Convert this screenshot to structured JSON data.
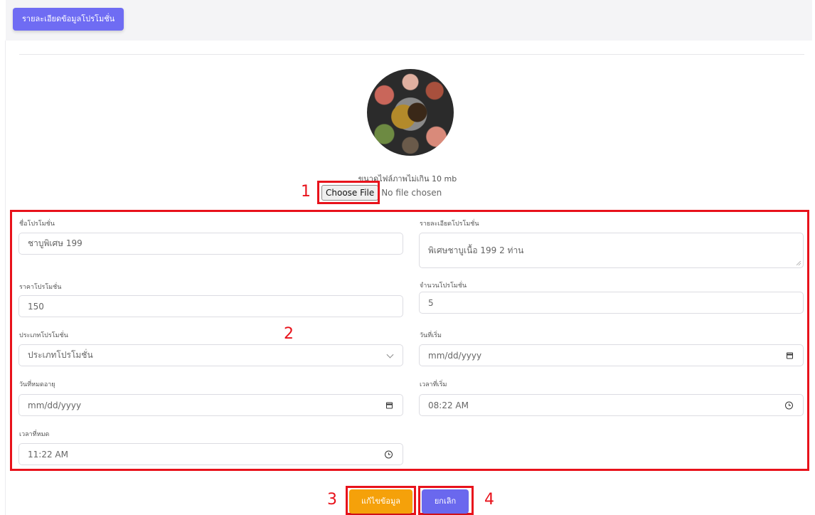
{
  "header": {
    "title": "รายละเอียดข้อมูลโปรโมชั่น"
  },
  "upload": {
    "size_note": "ขนาดไฟล์ภาพไม่เกิน 10 mb",
    "choose_file_label": "Choose File",
    "no_file_text": "No file chosen"
  },
  "form": {
    "name": {
      "label": "ชื่อโปรโมชั่น",
      "value": "ชาบูพิเศษ 199"
    },
    "detail": {
      "label": "รายละเอียดโปรโมชั่น",
      "value": "พิเศษชาบูเนื้อ 199 2 ท่าน"
    },
    "price": {
      "label": "ราคาโปรโมชั่น",
      "value": "150"
    },
    "quantity": {
      "label": "จำนวนโปรโมชั่น",
      "value": "5"
    },
    "type": {
      "label": "ประเภทโปรโมชั่น",
      "selected": "ประเภทโปรโมชั่น"
    },
    "start_date": {
      "label": "วันที่เริ่ม",
      "value": "mm/dd/yyyy"
    },
    "expire_date": {
      "label": "วันที่หมดอายุ",
      "value": "mm/dd/yyyy"
    },
    "start_time": {
      "label": "เวลาที่เริ่ม",
      "value": "08:22 AM"
    },
    "end_time": {
      "label": "เวลาที่หมด",
      "value": "11:22 AM"
    }
  },
  "actions": {
    "edit_label": "แก้ไขข้อมูล",
    "cancel_label": "ยกเลิก"
  },
  "annotations": {
    "one": "1",
    "two": "2",
    "three": "3",
    "four": "4"
  },
  "colors": {
    "primary": "#6f6cf3",
    "warning": "#f5a10a",
    "highlight": "#e8121b"
  },
  "icons": [
    "calendar-icon",
    "clock-icon",
    "chevron-down-icon",
    "resize-handle-icon"
  ]
}
